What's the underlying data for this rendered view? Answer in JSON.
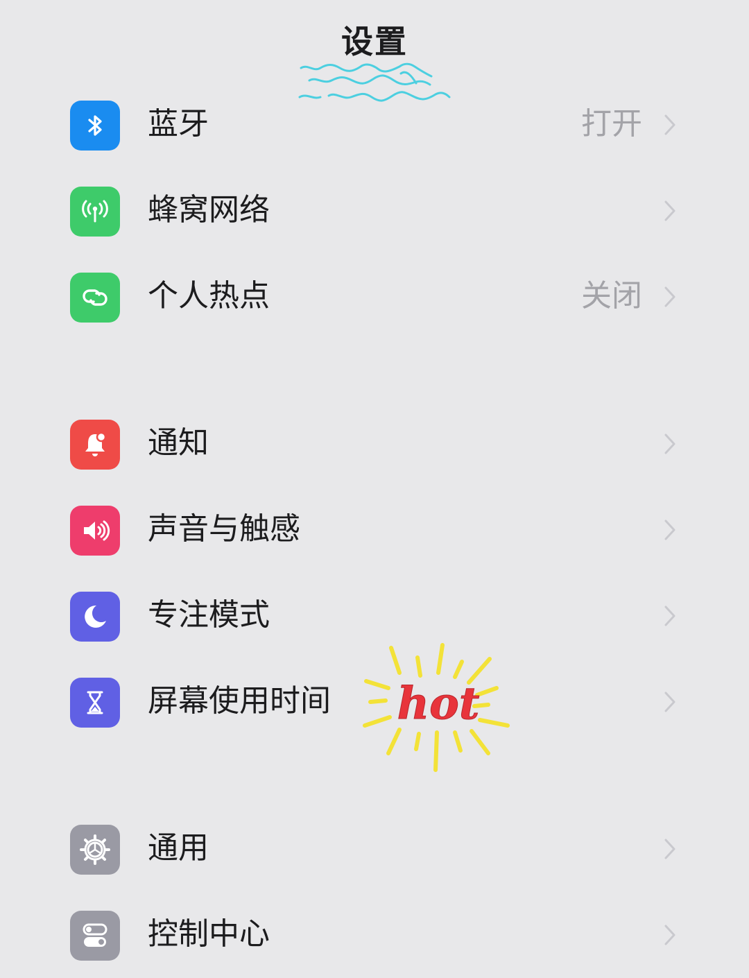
{
  "header": {
    "title": "设置"
  },
  "groups": [
    {
      "items": [
        {
          "label": "蓝牙",
          "value": "打开",
          "icon": "bluetooth-icon",
          "color": "#1a8cf0"
        },
        {
          "label": "蜂窝网络",
          "value": "",
          "icon": "cellular-antenna-icon",
          "color": "#3ecb6a"
        },
        {
          "label": "个人热点",
          "value": "关闭",
          "icon": "hotspot-link-icon",
          "color": "#3ecb6a"
        }
      ]
    },
    {
      "items": [
        {
          "label": "通知",
          "value": "",
          "icon": "bell-icon",
          "color": "#ef4b47"
        },
        {
          "label": "声音与触感",
          "value": "",
          "icon": "speaker-icon",
          "color": "#ee3d6c"
        },
        {
          "label": "专注模式",
          "value": "",
          "icon": "moon-icon",
          "color": "#6060e4"
        },
        {
          "label": "屏幕使用时间",
          "value": "",
          "icon": "hourglass-icon",
          "color": "#6060e4"
        }
      ]
    },
    {
      "items": [
        {
          "label": "通用",
          "value": "",
          "icon": "gear-icon",
          "color": "#9a9aa4"
        },
        {
          "label": "控制中心",
          "value": "",
          "icon": "toggle-switches-icon",
          "color": "#9a9aa4"
        }
      ]
    }
  ],
  "sticker": {
    "text": "hot",
    "text_color": "#e8343b",
    "ray_color": "#f3e238"
  },
  "decoration_color": "#4ccfe0",
  "chevron_color": "#c9c9ce"
}
